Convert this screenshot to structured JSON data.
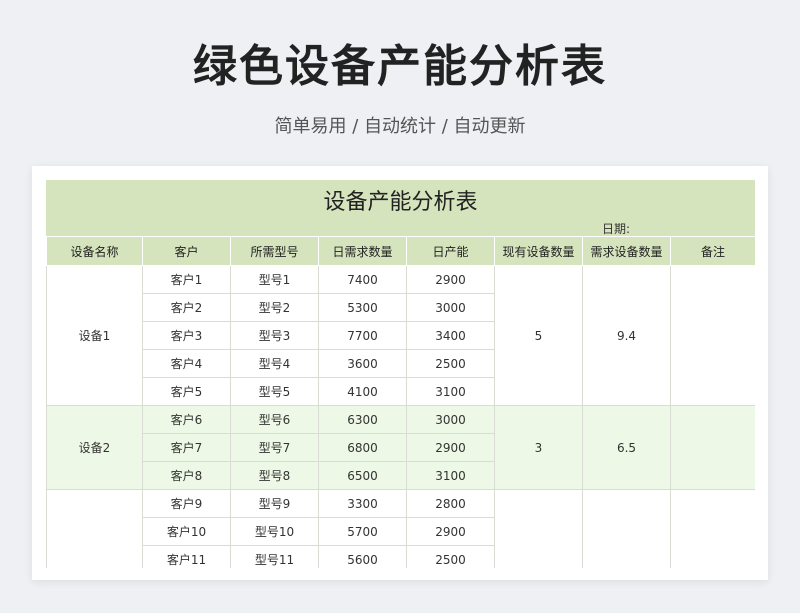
{
  "page": {
    "title": "绿色设备产能分析表",
    "subtitle": "简单易用 / 自动统计 / 自动更新"
  },
  "sheet": {
    "title": "设备产能分析表",
    "date_label": "日期:"
  },
  "table": {
    "headers": [
      "设备名称",
      "客户",
      "所需型号",
      "日需求数量",
      "日产能",
      "现有设备数量",
      "需求设备数量",
      "备注"
    ],
    "groups": [
      {
        "device": "设备1",
        "existing": "5",
        "required": "9.4",
        "note": "",
        "rows": [
          {
            "customer": "客户1",
            "model": "型号1",
            "demand": "7400",
            "capacity": "2900"
          },
          {
            "customer": "客户2",
            "model": "型号2",
            "demand": "5300",
            "capacity": "3000"
          },
          {
            "customer": "客户3",
            "model": "型号3",
            "demand": "7700",
            "capacity": "3400"
          },
          {
            "customer": "客户4",
            "model": "型号4",
            "demand": "3600",
            "capacity": "2500"
          },
          {
            "customer": "客户5",
            "model": "型号5",
            "demand": "4100",
            "capacity": "3100"
          }
        ]
      },
      {
        "device": "设备2",
        "existing": "3",
        "required": "6.5",
        "note": "",
        "rows": [
          {
            "customer": "客户6",
            "model": "型号6",
            "demand": "6300",
            "capacity": "3000"
          },
          {
            "customer": "客户7",
            "model": "型号7",
            "demand": "6800",
            "capacity": "2900"
          },
          {
            "customer": "客户8",
            "model": "型号8",
            "demand": "6500",
            "capacity": "3100"
          }
        ]
      },
      {
        "device": "",
        "existing": "",
        "required": "",
        "note": "",
        "rows": [
          {
            "customer": "客户9",
            "model": "型号9",
            "demand": "3300",
            "capacity": "2800"
          },
          {
            "customer": "客户10",
            "model": "型号10",
            "demand": "5700",
            "capacity": "2900"
          },
          {
            "customer": "客户11",
            "model": "型号11",
            "demand": "5600",
            "capacity": "2500"
          }
        ]
      }
    ]
  }
}
